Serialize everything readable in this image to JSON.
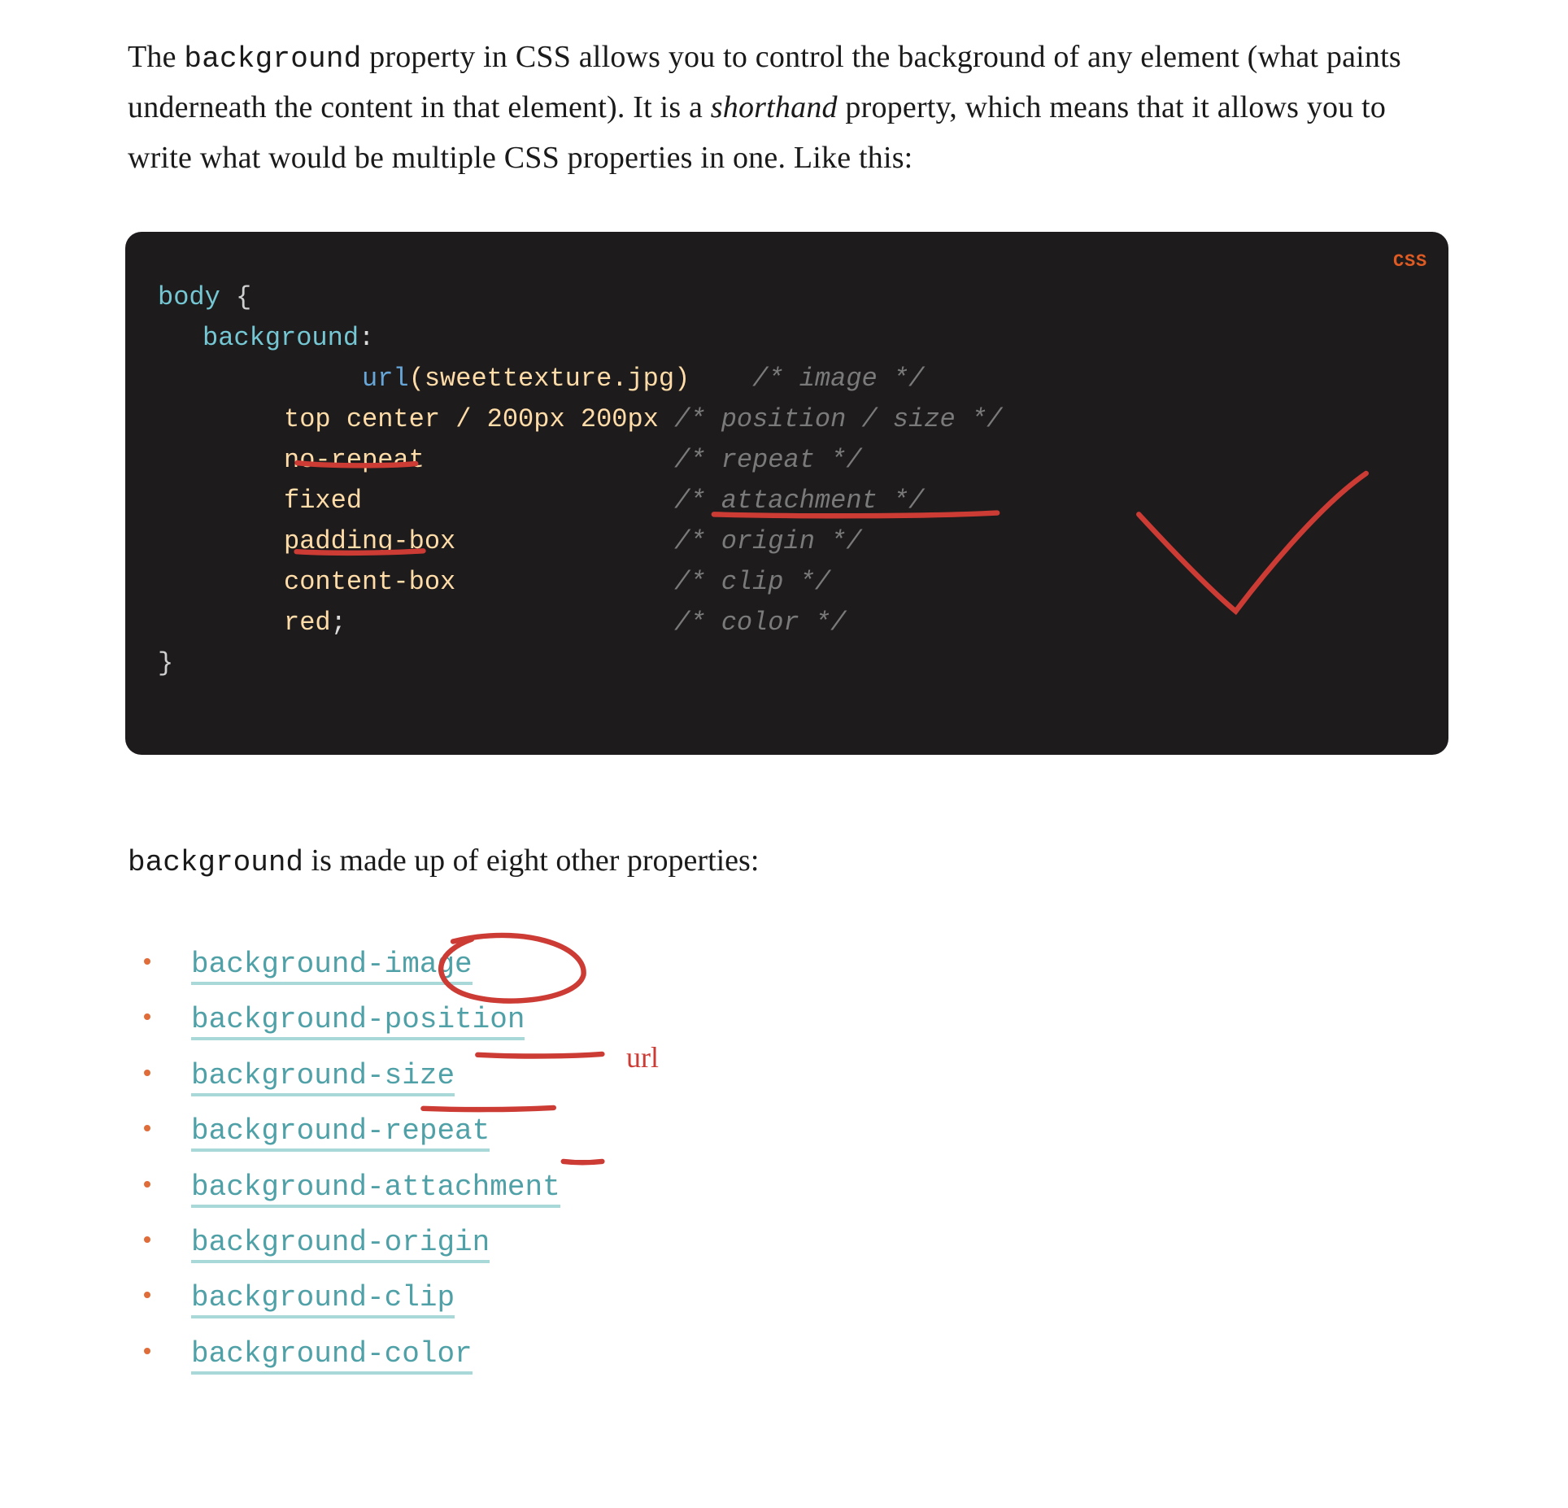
{
  "intro": {
    "pre": "The ",
    "code": "background",
    "mid1": " property in CSS allows you to control the background of any element (what paints underneath the content in that element). It is a ",
    "shorthand": "shorthand",
    "mid2": " property, which means that it allows you to write what would be multiple CSS properties in one. Like this:"
  },
  "code_badge": "CSS",
  "code": {
    "selector": "body",
    "open": "{",
    "property": "background",
    "colon": ":",
    "line_url_pre": "     ",
    "line_url_func": "url",
    "line_url_arg": "(sweettexture.jpg)",
    "line_url_pad": "    ",
    "line_url_comment": "/* image */",
    "line_pos_val": "top center / 200px 200px ",
    "line_pos_comment": "/* position / size */",
    "line_rep_val": "no-repeat",
    "line_rep_pad": "                ",
    "line_rep_comment": "/* repeat */",
    "line_att_val": "fixed",
    "line_att_pad": "                    ",
    "line_att_comment": "/* attachment */",
    "line_org_val": "padding-box",
    "line_org_pad": "              ",
    "line_org_comment": "/* origin */",
    "line_clip_val": "content-box",
    "line_clip_pad": "              ",
    "line_clip_comment": "/* clip */",
    "line_col_val": "red",
    "line_col_semi": ";",
    "line_col_pad": "                     ",
    "line_col_comment": "/* color */",
    "close": "}"
  },
  "after_code": {
    "code": "background",
    "text": " is made up of eight other properties:"
  },
  "props": [
    "background-image",
    "background-position",
    "background-size",
    "background-repeat",
    "background-attachment",
    "background-origin",
    "background-clip",
    "background-color"
  ],
  "anno_label": "url"
}
